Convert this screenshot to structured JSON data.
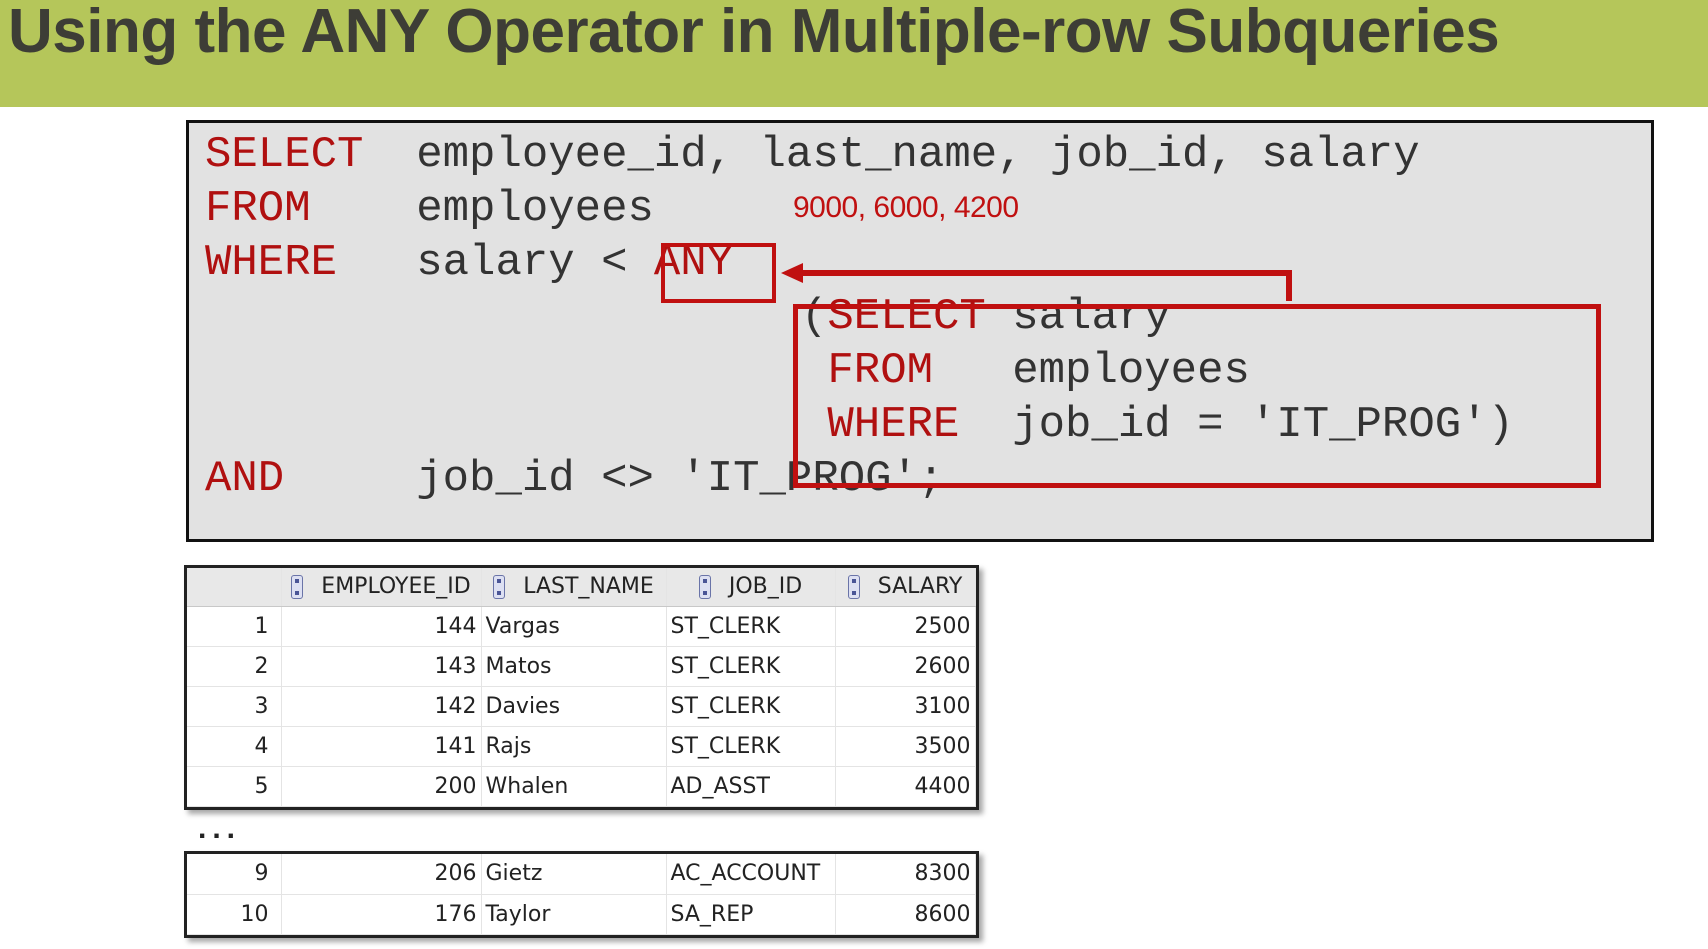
{
  "slide_title": "Using the ANY Operator in Multiple-row Subqueries",
  "sql": {
    "line1_keyword": "SELECT",
    "line1_text": "employee_id, last_name, job_id, salary",
    "line2_keyword": "FROM",
    "line2_text": "employees",
    "line3_keyword": "WHERE",
    "line3_text": "salary <",
    "any_operator": "ANY",
    "sub_open_paren": "(",
    "sub_line1_keyword": "SELECT",
    "sub_line1_text": "salary",
    "sub_line2_keyword": "FROM",
    "sub_line2_text": "employees",
    "sub_line3_keyword": "WHERE",
    "sub_line3_text": "job_id = 'IT_PROG')",
    "line4_keyword": "AND",
    "line4_text": "job_id <> 'IT_PROG';"
  },
  "subquery_result_note": "9000, 6000, 4200",
  "results": {
    "columns": [
      "EMPLOYEE_ID",
      "LAST_NAME",
      "JOB_ID",
      "SALARY"
    ],
    "rows_top": [
      {
        "n": "1",
        "employee_id": "144",
        "last_name": "Vargas",
        "job_id": "ST_CLERK",
        "salary": "2500"
      },
      {
        "n": "2",
        "employee_id": "143",
        "last_name": "Matos",
        "job_id": "ST_CLERK",
        "salary": "2600"
      },
      {
        "n": "3",
        "employee_id": "142",
        "last_name": "Davies",
        "job_id": "ST_CLERK",
        "salary": "3100"
      },
      {
        "n": "4",
        "employee_id": "141",
        "last_name": "Rajs",
        "job_id": "ST_CLERK",
        "salary": "3500"
      },
      {
        "n": "5",
        "employee_id": "200",
        "last_name": "Whalen",
        "job_id": "AD_ASST",
        "salary": "4400"
      }
    ],
    "ellipsis": "...",
    "rows_bottom": [
      {
        "n": "9",
        "employee_id": "206",
        "last_name": "Gietz",
        "job_id": "AC_ACCOUNT",
        "salary": "8300"
      },
      {
        "n": "10",
        "employee_id": "176",
        "last_name": "Taylor",
        "job_id": "SA_REP",
        "salary": "8600"
      }
    ]
  },
  "colors": {
    "title_bar": "#b5c65a",
    "keyword": "#b01010",
    "highlight": "#c01010",
    "code_bg": "#e2e2e2"
  },
  "icons": {
    "column_header": "sort-icon"
  }
}
